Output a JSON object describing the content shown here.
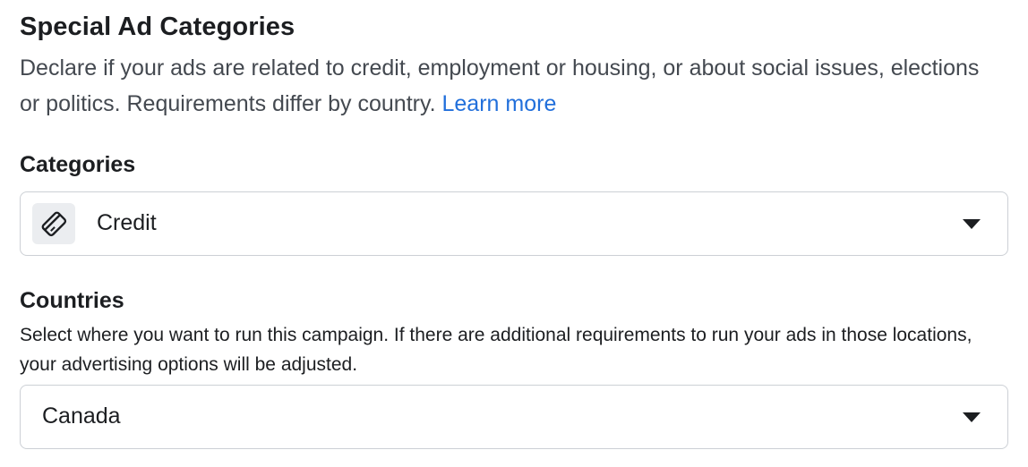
{
  "section": {
    "title": "Special Ad Categories",
    "description": "Declare if your ads are related to credit, employment or housing, or about social issues, elections or politics. Requirements differ by country.",
    "learn_more": "Learn more"
  },
  "categories": {
    "label": "Categories",
    "selected_value": "Credit",
    "icon": "credit-card-icon"
  },
  "countries": {
    "label": "Countries",
    "help_text": "Select where you want to run this campaign. If there are additional requirements to run your ads in those locations, your advertising options will be adjusted.",
    "selected_value": "Canada"
  },
  "colors": {
    "link": "#216fdb",
    "border": "#ccd0d5",
    "icon_bg": "#ebedf0"
  }
}
